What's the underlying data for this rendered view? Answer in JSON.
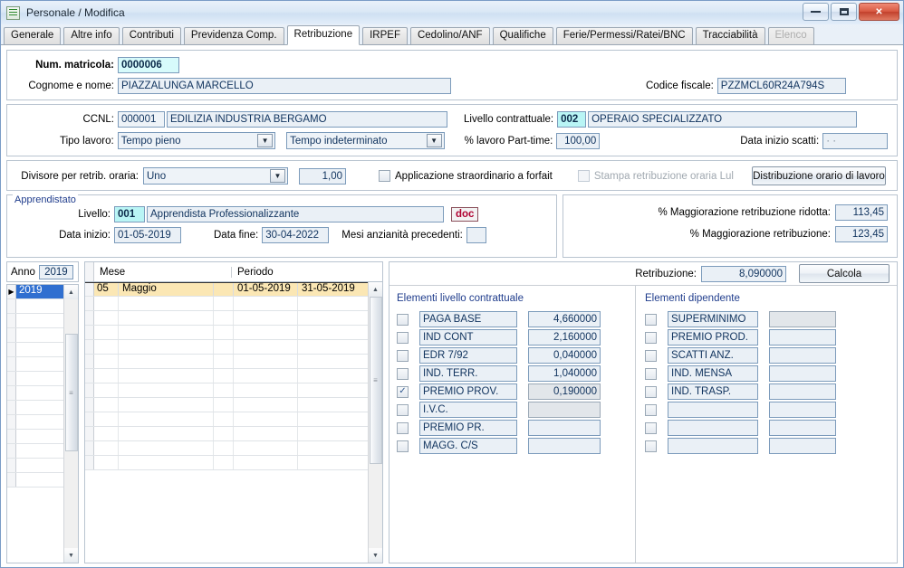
{
  "window": {
    "title": "Personale / Modifica",
    "icon": "document-list-icon",
    "minimize_label": "minimize",
    "maximize_label": "maximize",
    "close_label": "✕"
  },
  "tabs": [
    {
      "label": "Generale",
      "state": "normal"
    },
    {
      "label": "Altre info",
      "state": "normal"
    },
    {
      "label": "Contributi",
      "state": "normal"
    },
    {
      "label": "Previdenza Comp.",
      "state": "normal"
    },
    {
      "label": "Retribuzione",
      "state": "active"
    },
    {
      "label": "IRPEF",
      "state": "normal"
    },
    {
      "label": "Cedolino/ANF",
      "state": "normal"
    },
    {
      "label": "Qualifiche",
      "state": "normal"
    },
    {
      "label": "Ferie/Permessi/Ratei/BNC",
      "state": "normal"
    },
    {
      "label": "Tracciabilità",
      "state": "normal"
    },
    {
      "label": "Elenco",
      "state": "disabled"
    }
  ],
  "identity": {
    "matricola_label": "Num. matricola:",
    "matricola_value": "0000006",
    "nome_label": "Cognome e nome:",
    "nome_value": "PIAZZALUNGA MARCELLO",
    "codice_fiscale_label": "Codice fiscale:",
    "codice_fiscale_value": "PZZMCL60R24A794S"
  },
  "contract": {
    "ccnl_label": "CCNL:",
    "ccnl_code": "000001",
    "ccnl_desc": "EDILIZIA INDUSTRIA BERGAMO",
    "livello_label": "Livello contrattuale:",
    "livello_code": "002",
    "livello_desc": "OPERAIO SPECIALIZZATO",
    "tipo_lavoro_label": "Tipo lavoro:",
    "tipo_lavoro_1": "Tempo pieno",
    "tipo_lavoro_2": "Tempo indeterminato",
    "parttime_label": "% lavoro Part-time:",
    "parttime_value": "100,00",
    "data_scatti_label": "Data inizio scatti:",
    "data_scatti_value": "·   ·"
  },
  "divisore": {
    "label": "Divisore per retrib. oraria:",
    "combo_value": "Uno",
    "num_value": "1,00",
    "forfait_label": "Applicazione straordinario a forfait",
    "forfait_checked": false,
    "stampa_label": "Stampa retribuzione oraria Lul",
    "stampa_checked": false,
    "stampa_disabled": true,
    "distribuzione_button": "Distribuzione orario di lavoro"
  },
  "apprendistato": {
    "group_title": "Apprendistato",
    "livello_label": "Livello:",
    "livello_code": "001",
    "livello_desc": "Apprendista Professionalizzante",
    "doc_button": "doc",
    "data_inizio_label": "Data inizio:",
    "data_inizio_value": "01-05-2019",
    "data_fine_label": "Data fine:",
    "data_fine_value": "30-04-2022",
    "mesi_label": "Mesi anzianità precedenti:",
    "mesi_value": ""
  },
  "maggiorazione": {
    "ridotta_label": "% Maggiorazione retribuzione ridotta:",
    "ridotta_value": "113,45",
    "normale_label": "% Maggiorazione retribuzione:",
    "normale_value": "123,45"
  },
  "anno": {
    "label": "Anno",
    "value": "2019",
    "rows": [
      "2019",
      "",
      "",
      "",
      "",
      "",
      "",
      "",
      "",
      "",
      "",
      "",
      "",
      ""
    ],
    "selected_index": 0
  },
  "mese_grid": {
    "columns": [
      "Mese",
      "Periodo"
    ],
    "rows": [
      {
        "codice": "05",
        "mese": "Maggio",
        "dal": "01-05-2019",
        "al": "31-05-2019",
        "selected": true
      }
    ],
    "empty_rows": 12
  },
  "retribuzione": {
    "label": "Retribuzione:",
    "value": "8,090000",
    "calcola_button": "Calcola"
  },
  "elementi_livello": {
    "title": "Elementi livello contrattuale",
    "items": [
      {
        "checked": false,
        "name": "PAGA BASE",
        "value": "4,660000",
        "value_disabled": false
      },
      {
        "checked": false,
        "name": "IND CONT",
        "value": "2,160000",
        "value_disabled": false
      },
      {
        "checked": false,
        "name": "EDR 7/92",
        "value": "0,040000",
        "value_disabled": false
      },
      {
        "checked": false,
        "name": "IND. TERR.",
        "value": "1,040000",
        "value_disabled": false
      },
      {
        "checked": true,
        "name": "PREMIO PROV.",
        "value": "0,190000",
        "value_disabled": true
      },
      {
        "checked": false,
        "name": "I.V.C.",
        "value": "",
        "value_disabled": true
      },
      {
        "checked": false,
        "name": "PREMIO PR.",
        "value": "",
        "value_disabled": false
      },
      {
        "checked": false,
        "name": "MAGG. C/S",
        "value": "",
        "value_disabled": false
      }
    ]
  },
  "elementi_dipendente": {
    "title": "Elementi dipendente",
    "items": [
      {
        "checked": false,
        "name": "SUPERMINIMO",
        "value": "",
        "value_disabled": true
      },
      {
        "checked": false,
        "name": "PREMIO PROD.",
        "value": "",
        "value_disabled": false
      },
      {
        "checked": false,
        "name": "SCATTI ANZ.",
        "value": "",
        "value_disabled": false
      },
      {
        "checked": false,
        "name": "IND. MENSA",
        "value": "",
        "value_disabled": false
      },
      {
        "checked": false,
        "name": "IND. TRASP.",
        "value": "",
        "value_disabled": false
      },
      {
        "checked": false,
        "name": "",
        "value": "",
        "value_disabled": false
      },
      {
        "checked": false,
        "name": "",
        "value": "",
        "value_disabled": false
      },
      {
        "checked": false,
        "name": "",
        "value": "",
        "value_disabled": false
      }
    ]
  }
}
